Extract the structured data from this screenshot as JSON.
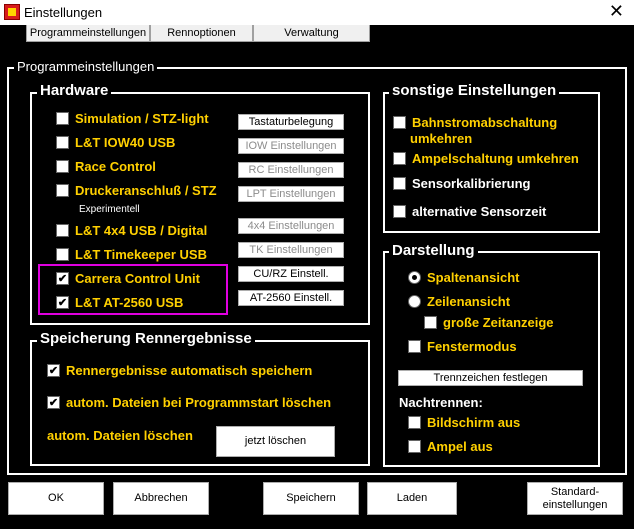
{
  "window": {
    "title": "Einstellungen",
    "close_glyph": "✕",
    "icon": "app-logo-icon"
  },
  "tabs": [
    "Programmeinstellungen",
    "Rennoptionen",
    "Verwaltung"
  ],
  "main_group": {
    "title": "Programmeinstellungen"
  },
  "hardware": {
    "title": "Hardware",
    "items": [
      {
        "label": "Simulation / STZ-light",
        "checked": false,
        "button": "Tastaturbelegung",
        "button_enabled": true
      },
      {
        "label": "L&T IOW40 USB",
        "checked": false,
        "button": "IOW Einstellungen",
        "button_enabled": false
      },
      {
        "label": "Race Control",
        "checked": false,
        "button": "RC Einstellungen",
        "button_enabled": false
      },
      {
        "label": "Druckeranschluß / STZ",
        "checked": false,
        "button": "LPT Einstellungen",
        "button_enabled": false
      },
      {
        "label": "L&T 4x4 USB / Digital",
        "checked": false,
        "button": "4x4 Einstellungen",
        "button_enabled": false
      },
      {
        "label": "L&T Timekeeper USB",
        "checked": false,
        "button": "TK Einstellungen",
        "button_enabled": false
      },
      {
        "label": "Carrera Control Unit",
        "checked": true,
        "button": "CU/RZ Einstell.",
        "button_enabled": true
      },
      {
        "label": "L&T AT-2560 USB",
        "checked": true,
        "button": "AT-2560 Einstell.",
        "button_enabled": true
      }
    ],
    "experimental_note": "Experimentell"
  },
  "sonstige": {
    "title": "sonstige Einstellungen",
    "items": [
      {
        "label": "Bahnstromabschaltung",
        "label2": "umkehren",
        "checked": false
      },
      {
        "label": "Ampelschaltung umkehren",
        "checked": false
      },
      {
        "label": "Sensorkalibrierung",
        "checked": false
      },
      {
        "label": "alternative Sensorzeit",
        "checked": false
      }
    ]
  },
  "darstellung": {
    "title": "Darstellung",
    "radio_spalten": "Spaltenansicht",
    "radio_zeilen": "Zeilenansicht",
    "selected": "Spaltenansicht",
    "grosse_zeitanzeige": "große Zeitanzeige",
    "fenstermodus": "Fenstermodus",
    "trennzeichen_button": "Trennzeichen festlegen",
    "nachtrennen_label": "Nachtrennen:",
    "bildschirm_aus": "Bildschirm aus",
    "ampel_aus": "Ampel aus"
  },
  "speicherung": {
    "title": "Speicherung Rennergebnisse",
    "auto_save": "Rennergebnisse automatisch speichern",
    "auto_save_checked": true,
    "auto_delete": "autom. Dateien bei Programmstart löschen",
    "auto_delete_checked": true,
    "delete_label": "autom. Dateien löschen",
    "delete_button": "jetzt löschen"
  },
  "footer": {
    "ok": "OK",
    "cancel": "Abbrechen",
    "save": "Speichern",
    "load": "Laden",
    "default_line1": "Standard-",
    "default_line2": "einstellungen"
  }
}
